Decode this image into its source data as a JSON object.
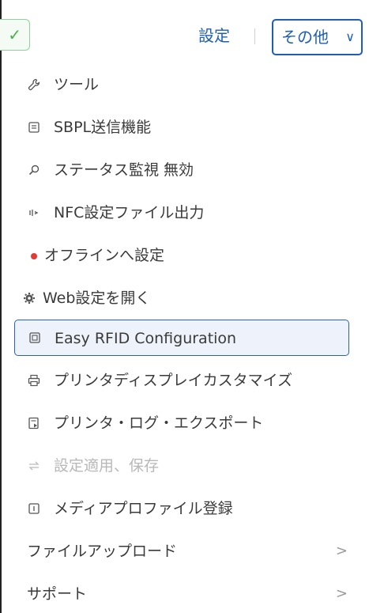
{
  "topbar": {
    "settings_label": "設定",
    "more_label": "その他",
    "check_glyph": "✓",
    "chevron_glyph": "∨"
  },
  "menu": {
    "items": [
      {
        "icon": "wrench-icon",
        "glyph": "🔧",
        "label": "ツール"
      },
      {
        "icon": "document-icon",
        "glyph": "▣",
        "label": "SBPL送信機能"
      },
      {
        "icon": "search-icon",
        "glyph": "⚲",
        "label": "ステータス監視 無効"
      },
      {
        "icon": "nfc-icon",
        "glyph": "⋈",
        "label": "NFC設定ファイル出力"
      },
      {
        "icon": "red-dot-icon",
        "glyph": "",
        "label": "オフラインへ設定"
      },
      {
        "icon": "gear-icon",
        "glyph": "⚙",
        "label": "Web設定を開く"
      },
      {
        "icon": "rfid-config-icon",
        "glyph": "▣",
        "label": "Easy RFID Configuration",
        "selected": true
      },
      {
        "icon": "printer-icon",
        "glyph": "⎙",
        "label": "プリンタディスプレイカスタマイズ"
      },
      {
        "icon": "log-export-icon",
        "glyph": "▤",
        "label": "プリンタ・ログ・エクスポート"
      },
      {
        "icon": "transfer-icon",
        "glyph": "⇆",
        "label": "設定適用、保存",
        "disabled": true
      },
      {
        "icon": "media-profile-icon",
        "glyph": "▣",
        "label": "メディアプロファイル登録"
      },
      {
        "icon": "",
        "glyph": "",
        "label": "ファイルアップロード",
        "submenu": true
      },
      {
        "icon": "",
        "glyph": "",
        "label": "サポート",
        "submenu": true
      }
    ],
    "submenu_glyph": ">"
  },
  "colors": {
    "accent": "#1e5fb4",
    "offline_dot": "#e53935",
    "success": "#4caf50"
  }
}
